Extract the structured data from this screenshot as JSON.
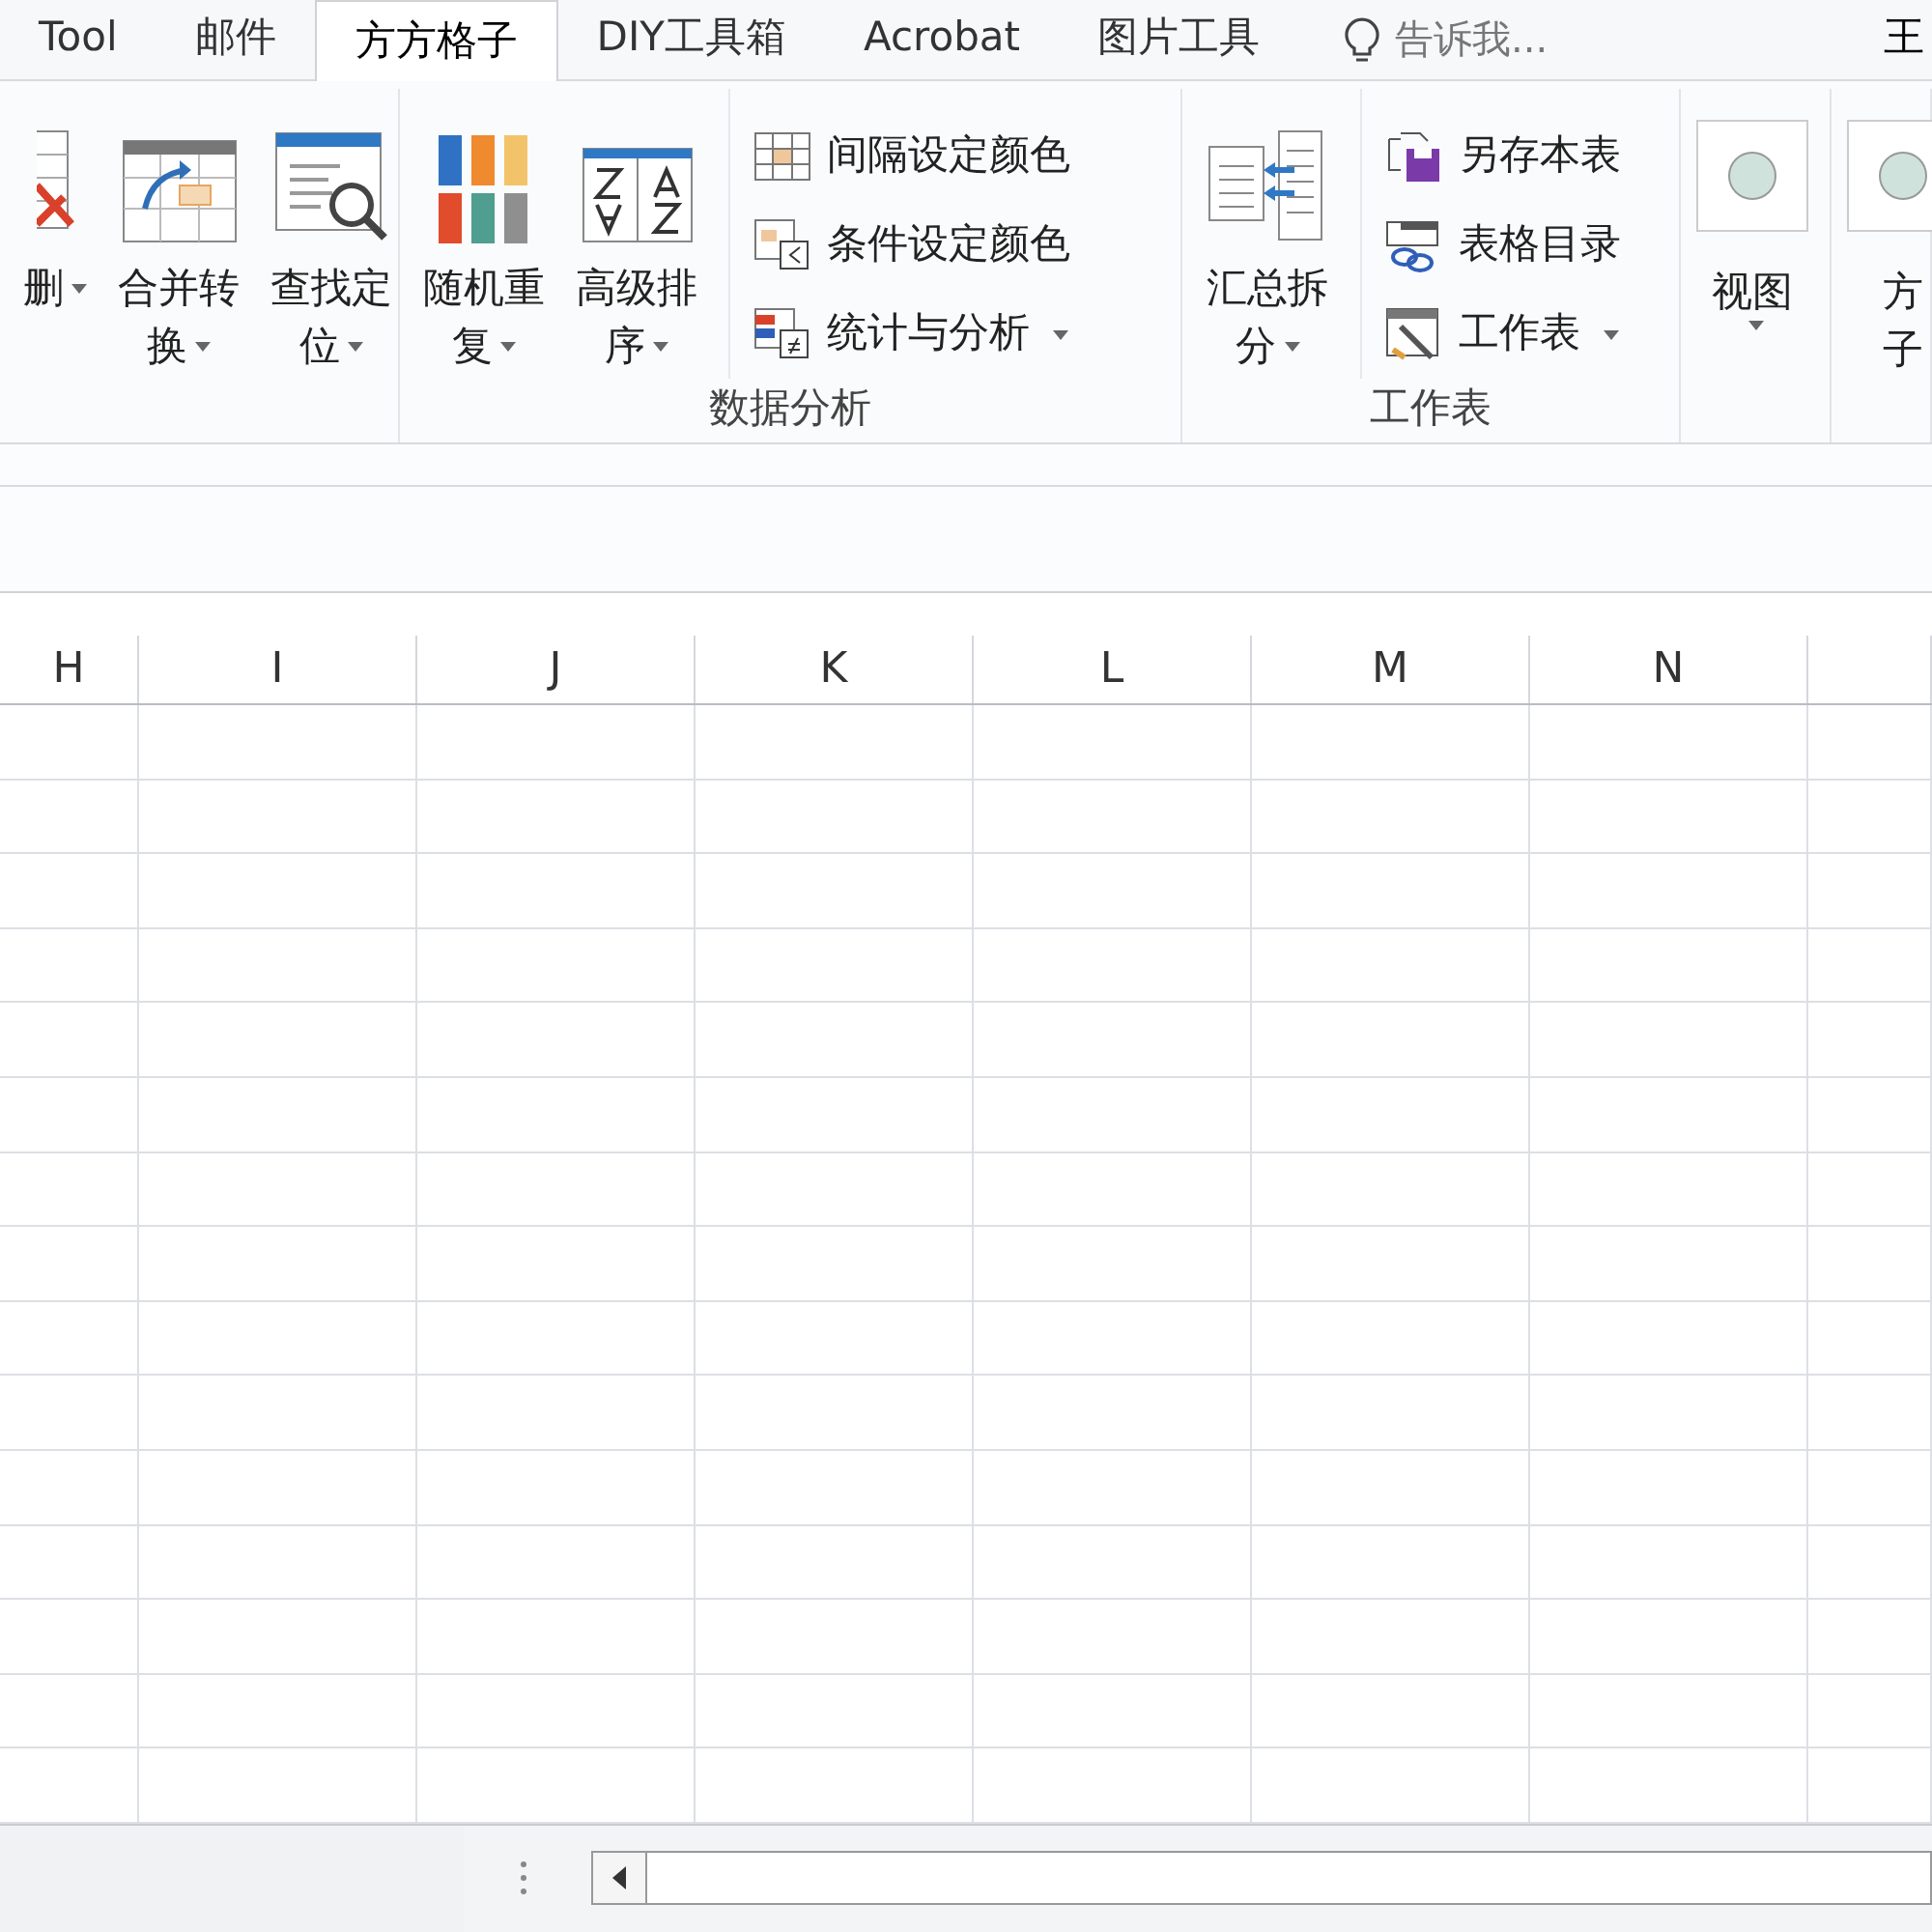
{
  "tabs": [
    {
      "label": "Tool",
      "selected": false
    },
    {
      "label": "邮件",
      "selected": false
    },
    {
      "label": "方方格子",
      "selected": true
    },
    {
      "label": "DIY工具箱",
      "selected": false
    },
    {
      "label": "Acrobat",
      "selected": false
    },
    {
      "label": "图片工具",
      "selected": false
    }
  ],
  "tell_me": {
    "placeholder": "告诉我..."
  },
  "account": "王",
  "ribbon": {
    "groups": [
      {
        "items": [
          {
            "kind": "large",
            "lines": [
              "删"
            ],
            "dropdown": true
          },
          {
            "kind": "large",
            "lines": [
              "合并转",
              "换"
            ],
            "dropdown": true
          },
          {
            "kind": "large",
            "lines": [
              "查找定",
              "位"
            ],
            "dropdown": true
          }
        ]
      },
      {
        "label": "数据分析",
        "items": [
          {
            "kind": "large",
            "lines": [
              "随机重",
              "复"
            ],
            "dropdown": true
          },
          {
            "kind": "large",
            "lines": [
              "高级排",
              "序"
            ],
            "dropdown": true
          },
          {
            "kind": "small",
            "label": "间隔设定颜色",
            "dropdown": false
          },
          {
            "kind": "small",
            "label": "条件设定颜色",
            "dropdown": false
          },
          {
            "kind": "small",
            "label": "统计与分析",
            "dropdown": true
          }
        ]
      },
      {
        "label": "工作表",
        "items": [
          {
            "kind": "large",
            "lines": [
              "汇总拆",
              "分"
            ],
            "dropdown": true
          },
          {
            "kind": "small",
            "label": "另存本表",
            "dropdown": false
          },
          {
            "kind": "small",
            "label": "表格目录",
            "dropdown": false
          },
          {
            "kind": "small",
            "label": "工作表",
            "dropdown": true
          }
        ]
      },
      {
        "items": [
          {
            "kind": "boxed",
            "lines": [
              "视图"
            ],
            "dropdown": true
          }
        ]
      },
      {
        "items": [
          {
            "kind": "boxed",
            "lines": [
              "方",
              "子"
            ],
            "dropdown": false
          }
        ]
      }
    ]
  },
  "columns": [
    "H",
    "I",
    "J",
    "K",
    "L",
    "M",
    "N",
    ""
  ]
}
